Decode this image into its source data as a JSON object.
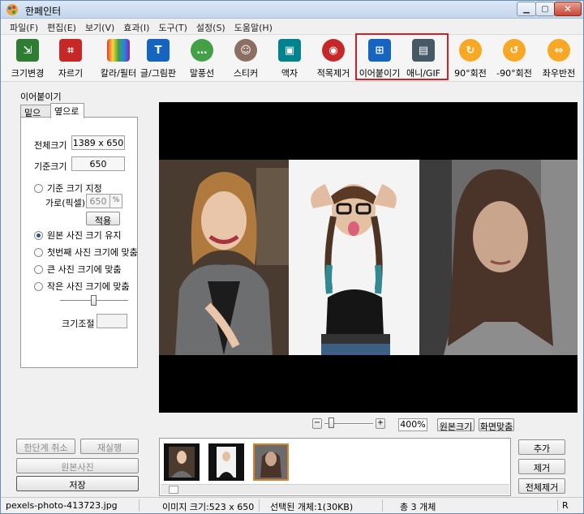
{
  "window": {
    "title": "한페인터"
  },
  "menu": [
    "파일(F)",
    "편집(E)",
    "보기(V)",
    "효과(I)",
    "도구(T)",
    "설정(S)",
    "도움말(H)"
  ],
  "toolbar": [
    {
      "label": "크기변경",
      "icon": "resize-icon",
      "color": "#2e7d32"
    },
    {
      "label": "자르기",
      "icon": "crop-icon",
      "color": "#c62828"
    },
    {
      "label": "칼라/필터",
      "icon": "color-filter-icon",
      "color": "#6a1b9a"
    },
    {
      "label": "글/그림판",
      "icon": "text-draw-icon",
      "color": "#1565c0"
    },
    {
      "label": "말풍선",
      "icon": "speech-bubble-icon",
      "color": "#43a047"
    },
    {
      "label": "스티커",
      "icon": "sticker-icon",
      "color": "#8d6e63"
    },
    {
      "label": "액자",
      "icon": "frame-icon",
      "color": "#00838f"
    },
    {
      "label": "적목제거",
      "icon": "red-eye-icon",
      "color": "#c62828"
    },
    {
      "label": "이어붙이기",
      "icon": "merge-icon",
      "color": "#1565c0"
    },
    {
      "label": "애니/GIF",
      "icon": "gif-icon",
      "color": "#455a64"
    },
    {
      "label": "90°회전",
      "icon": "rotate-cw-icon",
      "color": "#f9a825"
    },
    {
      "label": "-90°회전",
      "icon": "rotate-ccw-icon",
      "color": "#f9a825"
    },
    {
      "label": "좌우반전",
      "icon": "flip-icon",
      "color": "#f9a825"
    }
  ],
  "left_panel": {
    "title": "이어붙이기",
    "tabs": [
      "밑으로",
      "옆으로"
    ],
    "total_size_label": "전체크기",
    "total_size_value": "1389 x 650",
    "base_size_label": "기준크기",
    "base_size_value": "650",
    "opt_fixed": "기준 크기 지정",
    "width_label": "가로(픽셀)",
    "width_value": "650",
    "apply_button": "적용",
    "opt_keep": "원본 사진 크기 유지",
    "opt_first": "첫번째 사진 크기에 맞춤",
    "opt_large": "큰 사진 크기에 맞춤",
    "opt_small": "작은 사진 크기에 맞춤",
    "size_adjust_label": "크기조절",
    "undo_button": "한단계 취소",
    "redo_button": "재실행",
    "original_button": "원본사진",
    "save_button": "저장"
  },
  "zoom": {
    "value": "400%",
    "original_size": "원본크기",
    "fit_screen": "화면맞춤"
  },
  "right_buttons": {
    "add": "추가",
    "remove": "제거",
    "remove_all": "전체제거"
  },
  "status": {
    "filename": "pexels-photo-413723.jpg",
    "image_size": "이미지 크기:523 x 650",
    "selected": "선택된 개체:1(30KB)",
    "total": "총 3 개체",
    "right": "R"
  }
}
